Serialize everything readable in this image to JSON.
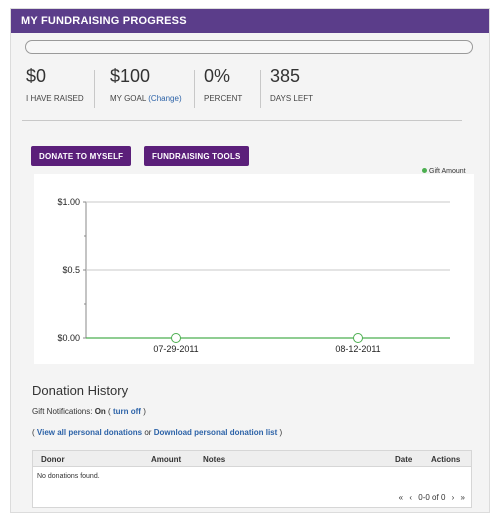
{
  "title": "MY FUNDRAISING PROGRESS",
  "progress": {
    "percent_value": 0
  },
  "stats": [
    {
      "value": "$0",
      "label": "I HAVE RAISED"
    },
    {
      "value": "$100",
      "label": "MY GOAL",
      "link": "(Change)"
    },
    {
      "value": "0%",
      "label": "PERCENT"
    },
    {
      "value": "385",
      "label": "DAYS LEFT"
    }
  ],
  "buttons": {
    "donate": "DONATE TO MYSELF",
    "tools": "FUNDRAISING TOOLS"
  },
  "chart_data": {
    "type": "line",
    "x": [
      "07-29-2011",
      "08-12-2011"
    ],
    "series": [
      {
        "name": "Gift Amount",
        "values": [
          0,
          0
        ]
      }
    ],
    "y_ticks": [
      "$1.00",
      "$0.5",
      "$0.00"
    ],
    "ylim": [
      0,
      1
    ],
    "grid": true,
    "legend": "top-right",
    "line_color": "#4caf50"
  },
  "donation_history": {
    "title": "Donation History",
    "notif_label": "Gift Notifications:",
    "notif_state": "On",
    "notif_open": "(",
    "turn_off": "turn off",
    "notif_close": ")",
    "links_open": "(",
    "view_all": "View all personal donations",
    "or": "or",
    "download": "Download personal donation list",
    "links_close": ")"
  },
  "table": {
    "headers": [
      "Donor",
      "Amount",
      "Notes",
      "Date",
      "Actions"
    ],
    "empty": "No donations found.",
    "pager": {
      "first": "«",
      "prev": "‹",
      "range": "0-0 of 0",
      "next": "›",
      "last": "»"
    }
  }
}
